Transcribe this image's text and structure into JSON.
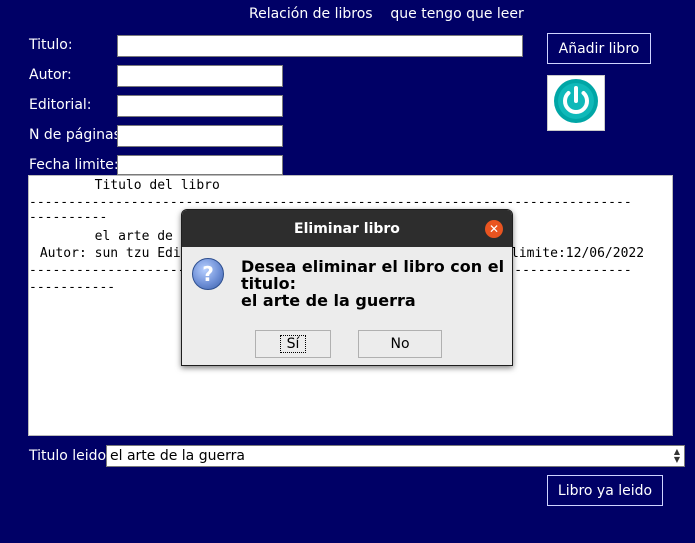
{
  "header": {
    "title": "Relación de libros    que tengo que leer"
  },
  "form": {
    "titulo_label": "Titulo:",
    "autor_label": "Autor:",
    "editorial_label": "Editorial:",
    "paginas_label": "N de páginas:",
    "fecha_label": "Fecha limite:",
    "titulo_value": "",
    "autor_value": "",
    "editorial_value": "",
    "paginas_value": "",
    "fecha_value": ""
  },
  "buttons": {
    "add_label": "Añadir libro",
    "read_label": "Libro ya leido",
    "power_icon": "power-icon"
  },
  "list": {
    "header": "        Titulo del libro",
    "sep1": "-----------------------------------------------------------------------------",
    "sep1_wrap": "----------",
    "entry_title": "        el arte de",
    "entry_meta_left": " Autor: sun tzu Edi",
    "entry_meta_right": "limite:12/06/2022",
    "sep2": "-----------------------------------------------------------------------------",
    "sep2_wrap": "-----------"
  },
  "leido": {
    "label": "Titulo leido:",
    "selected": "el arte de la guerra"
  },
  "dialog": {
    "title": "Eliminar libro",
    "message_line1": "Desea eliminar el libro con el",
    "message_line2": "titulo:",
    "message_line3": "el arte de la guerra",
    "yes_label": "Sí",
    "no_label": "No",
    "close_glyph": "✕",
    "question_glyph": "?"
  },
  "colors": {
    "background": "#000066",
    "dialog_header": "#2d2d2d",
    "close_button": "#e95420"
  }
}
